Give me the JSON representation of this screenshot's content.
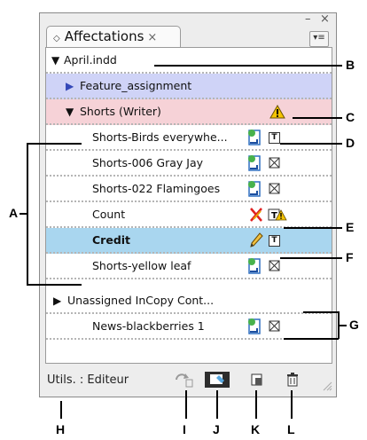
{
  "panel": {
    "tab_title": "Affectations",
    "tab_close": "×",
    "minimize_glyph": "–",
    "close_glyph": "×",
    "menu_glyph": "▾≡"
  },
  "rows": [
    {
      "label": "April.indd",
      "type": "document"
    },
    {
      "label": "Feature_assignment",
      "type": "assignment-collapsed"
    },
    {
      "label": "Shorts (Writer)",
      "type": "assignment-expanded",
      "warning": true
    },
    {
      "label": "Shorts-Birds everywhe...",
      "icons": [
        "incopy-story",
        "text-frame"
      ]
    },
    {
      "label": "Shorts-006 Gray Jay",
      "icons": [
        "incopy-story",
        "graphic-frame"
      ]
    },
    {
      "label": "Shorts-022 Flamingoes",
      "icons": [
        "incopy-story",
        "graphic-frame"
      ]
    },
    {
      "label": "Count",
      "icons": [
        "missing-link",
        "text-frame-warning"
      ]
    },
    {
      "label": "Credit",
      "icons": [
        "edit-pencil",
        "text-frame"
      ],
      "selected": true
    },
    {
      "label": "Shorts-yellow leaf",
      "icons": [
        "incopy-story",
        "graphic-frame"
      ]
    },
    {
      "label": "Unassigned InCopy Cont...",
      "type": "group-collapsed"
    },
    {
      "label": "News-blackberries 1",
      "icons": [
        "incopy-story",
        "graphic-frame"
      ]
    }
  ],
  "footer": {
    "user_text": "Utils. : Editeur",
    "buttons": [
      "update-content-icon",
      "edit-assignment-icon",
      "new-assignment-icon",
      "delete-icon"
    ]
  },
  "callouts": [
    "A",
    "B",
    "C",
    "D",
    "E",
    "F",
    "G",
    "H",
    "I",
    "J",
    "K",
    "L"
  ],
  "colors": {
    "assignment_blue": "#cfd3f7",
    "assignment_pink": "#f6d2d7",
    "selection": "#a9d6ef",
    "warning_yellow": "#f5c400"
  }
}
